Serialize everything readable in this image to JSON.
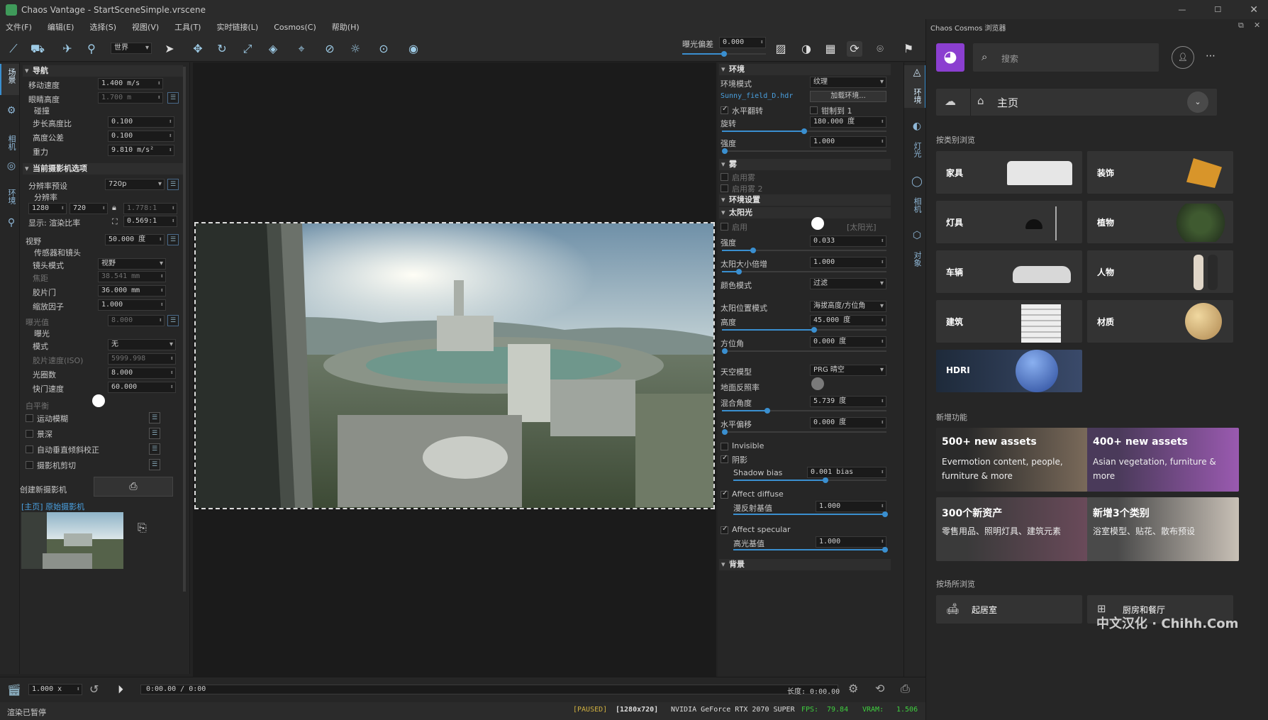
{
  "app": {
    "title": "Chaos Vantage - StartSceneSimple.vrscene"
  },
  "menu": [
    "文件(F)",
    "编辑(E)",
    "选择(S)",
    "视图(V)",
    "工具(T)",
    "实时链接(L)",
    "Cosmos(C)",
    "帮助(H)"
  ],
  "toolbar": {
    "space_select": "世界",
    "exposure_label": "曝光偏差",
    "exposure_value": "0.000"
  },
  "left_tabs": [
    "场景",
    "相机",
    "环境",
    "对象"
  ],
  "left": {
    "nav_title": "导航",
    "move_speed_label": "移动速度",
    "move_speed": "1.400 m/s",
    "eye_height_label": "眼睛高度",
    "eye_height": "1.700 m",
    "collision_label": "碰撞",
    "step_ratio_label": "步长高度比",
    "step_ratio": "0.100",
    "height_tol_label": "高度公差",
    "height_tol": "0.100",
    "gravity_label": "重力",
    "gravity": "9.810 m/s²",
    "camera_title": "当前摄影机选项",
    "res_preset_label": "分辨率预设",
    "res_preset": "720p",
    "resolution_label": "分辨率",
    "res_w": "1280",
    "res_h": "720",
    "res_ratio": "1.778:1",
    "display_label": "显示: 渲染比率",
    "display_ratio": "0.569:1",
    "fov_label": "视野",
    "fov": "50.000 度",
    "sensor_label": "传感器和镜头",
    "lens_mode_label": "镜头模式",
    "lens_mode": "视野",
    "focal_label": "焦距",
    "focal": "38.541 mm",
    "film_gate_label": "胶片门",
    "film_gate": "36.000 mm",
    "zoom_label": "缩放因子",
    "zoom": "1.000",
    "ev_label": "曝光值",
    "ev": "8.000",
    "exposure_sub": "曝光",
    "mode_label": "模式",
    "mode": "无",
    "iso_label": "胶片速度(ISO)",
    "iso": "5999.998",
    "fnum_label": "光圈数",
    "fnum": "8.000",
    "shutter_label": "快门速度",
    "shutter": "60.000",
    "wb_label": "白平衡",
    "motion_blur": "运动模糊",
    "dof": "景深",
    "vert_tilt": "自动垂直倾斜校正",
    "clipping": "摄影机剪切",
    "new_cam_label": "创建新摄影机",
    "cam_item": "[主页] 原始摄影机"
  },
  "right_tabs": [
    "环境",
    "灯光",
    "相机",
    "对象"
  ],
  "env": {
    "title": "环境",
    "mode_label": "环境模式",
    "mode": "纹理",
    "hdr_file": "Sunny_field_D.hdr",
    "load_btn": "加载环境...",
    "hflip": "水平翻转",
    "clamp": "钳制到 1",
    "rotation_label": "旋转",
    "rotation": "180.000 度",
    "intensity_label": "强度",
    "intensity": "1.000",
    "fog_title": "雾",
    "fog1": "启用雾",
    "fog2": "启用雾 2",
    "env_settings": "环境设置",
    "sun_title": "太阳光",
    "sun_enable": "启用",
    "sun_name": "[太阳光]",
    "sun_int_label": "强度",
    "sun_int": "0.033",
    "sun_size_label": "太阳大小倍增",
    "sun_size": "1.000",
    "color_mode_label": "颜色模式",
    "color_mode": "过滤",
    "pos_mode_label": "太阳位置模式",
    "pos_mode": "海拔高度/方位角",
    "alt_label": "高度",
    "alt": "45.000 度",
    "azi_label": "方位角",
    "azi": "0.000 度",
    "sky_label": "天空模型",
    "sky": "PRG 晴空",
    "ground_label": "地面反照率",
    "blend_label": "混合角度",
    "blend": "5.739 度",
    "hoff_label": "水平偏移",
    "hoff": "0.000 度",
    "invisible": "Invisible",
    "shadows": "阴影",
    "shadow_bias_label": "Shadow bias",
    "shadow_bias": "0.001 bias",
    "affect_diffuse": "Affect diffuse",
    "diffuse_base_label": "漫反射基值",
    "diffuse_base": "1.000",
    "affect_specular": "Affect specular",
    "spec_base_label": "高光基值",
    "spec_base": "1.000",
    "background": "背景"
  },
  "timeline": {
    "speed": "1.000 x",
    "time": "0:00.00 / 0:00",
    "length": "长度: 0:00.00"
  },
  "status": {
    "left": "渲染已暂停",
    "paused": "[PAUSED]",
    "res": "[1280x720]",
    "gpu": "NVIDIA GeForce RTX 2070 SUPER",
    "fps_label": "FPS:",
    "fps": "79.84",
    "vram_label": "VRAM:",
    "vram": "1.506",
    "watermark": "中文汉化 · Chihh.Com"
  },
  "cosmos": {
    "title": "Chaos Cosmos 浏览器",
    "search_placeholder": "搜索",
    "home": "主页",
    "browse_cat": "按类别浏览",
    "categories": [
      "家具",
      "装饰",
      "灯具",
      "植物",
      "车辆",
      "人物",
      "建筑",
      "材质",
      "HDRI"
    ],
    "whats_new": "新增功能",
    "news": [
      {
        "t": "500+ new assets",
        "d": "Evermotion content, people, furniture & more"
      },
      {
        "t": "400+ new assets",
        "d": "Asian vegetation, furniture & more"
      },
      {
        "t": "300个新资产",
        "d": "零售用品、照明灯具、建筑元素"
      },
      {
        "t": "新增3个类别",
        "d": "浴室模型、贴花、散布预设"
      }
    ],
    "browse_room": "按场所浏览",
    "rooms": [
      "起居室",
      "厨房和餐厅"
    ]
  },
  "colors": {
    "accent": "#3a8fd0",
    "cosmos_logo": "#8b3fd0",
    "fps": "#3fd03f",
    "paused": "#d0b040"
  }
}
